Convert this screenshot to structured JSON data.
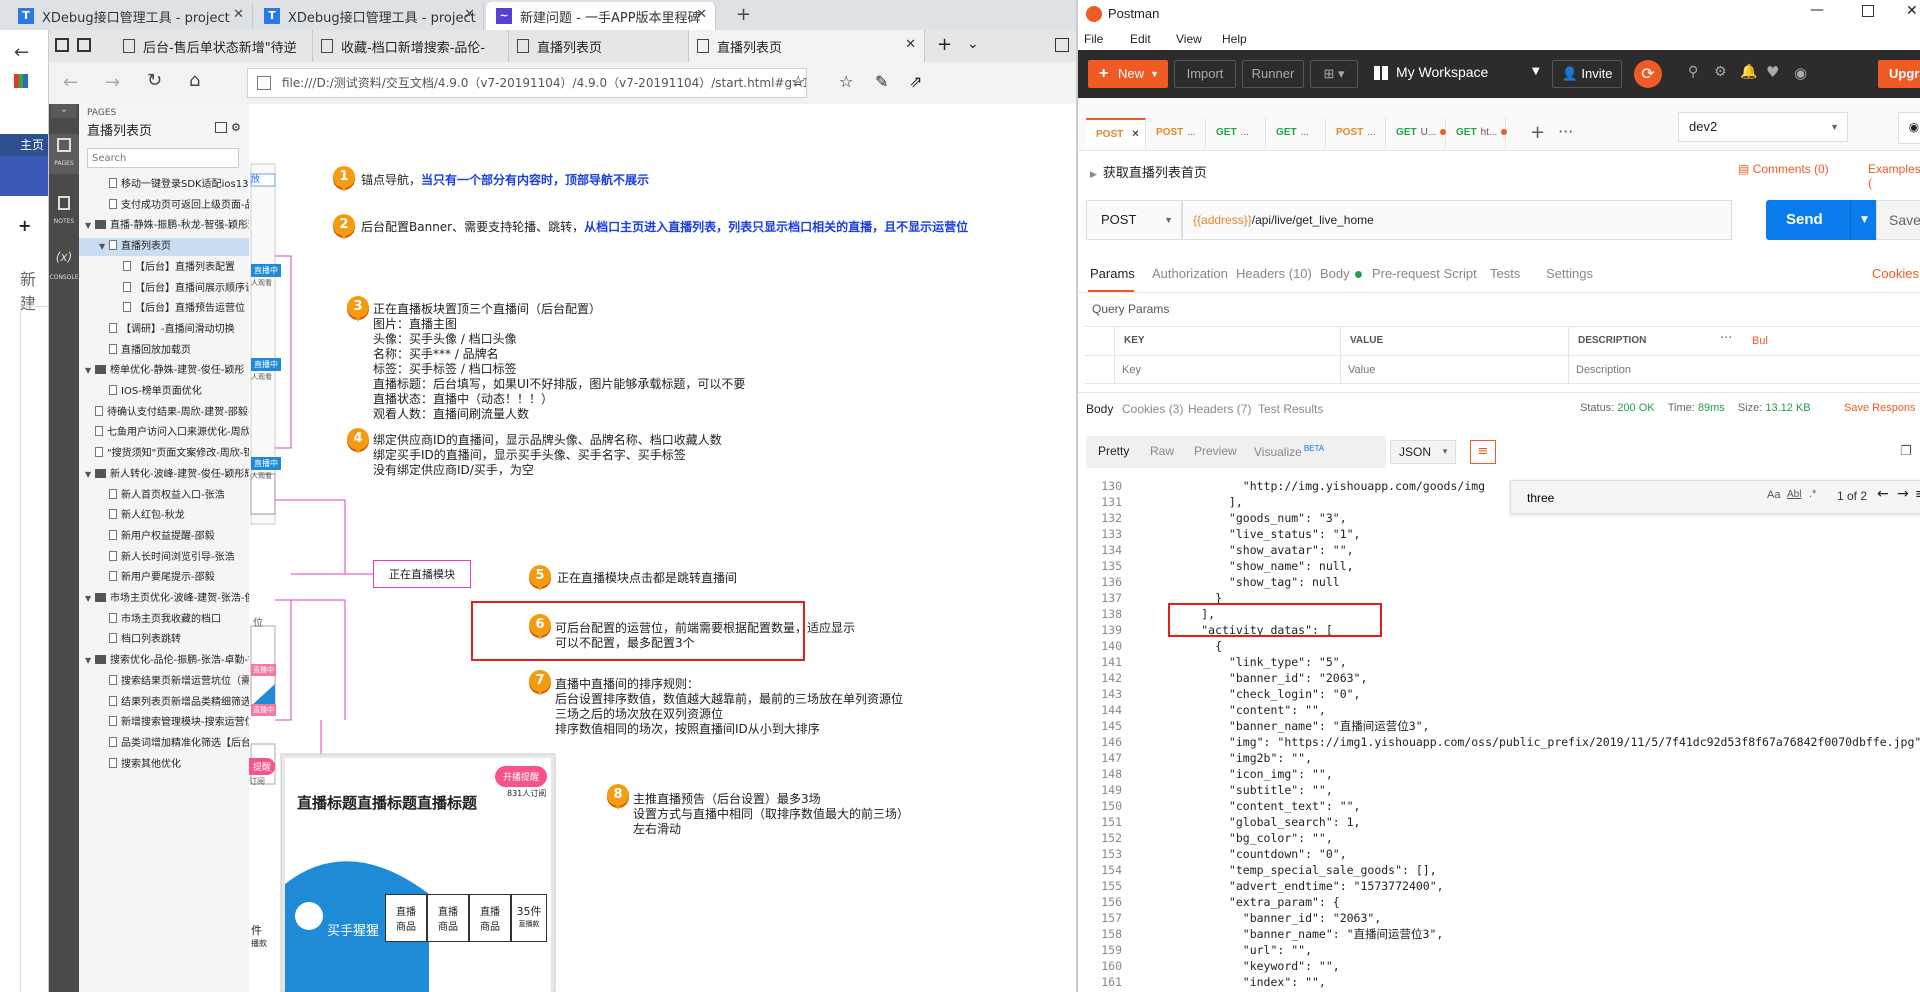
{
  "chrome": {
    "tabs": [
      {
        "label": "XDebug接口管理工具 - project",
        "icon": "T"
      },
      {
        "label": "XDebug接口管理工具 - project",
        "icon": "T"
      },
      {
        "label": "新建问题 - 一手APP版本里程碑",
        "icon": "~"
      }
    ],
    "new_tab": "+",
    "side_texts": [
      "主页",
      "新建"
    ]
  },
  "browser": {
    "tabs": [
      {
        "label": "后台-售后单状态新增\"待逆"
      },
      {
        "label": "收藏-档口新增搜索-品伦-"
      },
      {
        "label": "直播列表页"
      },
      {
        "label": "直播列表页"
      }
    ],
    "address": "file:///D:/测试资料/交互文档/4.9.0（v7-20191104）/4.9.0（v7-20191104）/start.html#g=1&p=直播列表页"
  },
  "axure": {
    "rail": {
      "pages": "PAGES",
      "notes": "NOTES",
      "console": "CONSOLE",
      "console_symbol": "(x)"
    },
    "header_label": "PAGES",
    "title": "直播列表页",
    "search_placeholder": "Search",
    "tree": [
      {
        "label": "移动一键登录SDK适配ios13【ios】-",
        "indent": 1,
        "type": "page"
      },
      {
        "label": "支付成功页可返回上级页面-品伦-建彰",
        "indent": 1,
        "type": "page"
      },
      {
        "label": "直播-静姝-振鹏-秋龙-智强-颖彤辉锋-",
        "indent": 0,
        "type": "folder",
        "open": true
      },
      {
        "label": "直播列表页",
        "indent": 1,
        "type": "page",
        "open": true,
        "selected": true
      },
      {
        "label": "【后台】直播列表配置",
        "indent": 2,
        "type": "page"
      },
      {
        "label": "【后台】直播间展示顺序设置",
        "indent": 2,
        "type": "page"
      },
      {
        "label": "【后台】直播预告运营位",
        "indent": 2,
        "type": "page"
      },
      {
        "label": "【调研】-直播间滑动切换",
        "indent": 1,
        "type": "page"
      },
      {
        "label": "直播回放加载页",
        "indent": 1,
        "type": "page"
      },
      {
        "label": "榜单优化-静姝-建贺-俊任-颖彤",
        "indent": 0,
        "type": "folder",
        "open": true
      },
      {
        "label": "IOS-榜单页面优化",
        "indent": 1,
        "type": "page"
      },
      {
        "label": "待确认支付结果-周欣-建贺-邵毅-卓勤",
        "indent": 0,
        "type": "page"
      },
      {
        "label": "七鱼用户访问入口来源优化-周欣-达尔",
        "indent": 0,
        "type": "page"
      },
      {
        "label": "\"搜货须知\"页面文案修改-周欣-锦星-",
        "indent": 0,
        "type": "page"
      },
      {
        "label": "新人转化-波峰-建贺-俊任-颖彤辉锋",
        "indent": 0,
        "type": "folder",
        "open": true
      },
      {
        "label": "新人首页权益入口-张浩",
        "indent": 1,
        "type": "page"
      },
      {
        "label": "新人红包-秋龙",
        "indent": 1,
        "type": "page"
      },
      {
        "label": "新用户权益提醒-邵毅",
        "indent": 1,
        "type": "page"
      },
      {
        "label": "新人长时间浏览引导-张浩",
        "indent": 1,
        "type": "page"
      },
      {
        "label": "新用户要尾提示-邵毅",
        "indent": 1,
        "type": "page"
      },
      {
        "label": "市场主页优化-波峰-建贺-张浩-俊任-",
        "indent": 0,
        "type": "folder",
        "open": true
      },
      {
        "label": "市场主页我收藏的档口",
        "indent": 1,
        "type": "page"
      },
      {
        "label": "档口列表跳转",
        "indent": 1,
        "type": "page"
      },
      {
        "label": "搜索优化-品伦-振鹏-张浩-卓勤-锦星-",
        "indent": 0,
        "type": "folder",
        "open": true
      },
      {
        "label": "搜索结果页新增运营坑位（需ab",
        "indent": 1,
        "type": "page"
      },
      {
        "label": "结果列表页新增品类精细筛选（需",
        "indent": 1,
        "type": "page"
      },
      {
        "label": "新增搜索管理模块-搜索运营位【",
        "indent": 1,
        "type": "page"
      },
      {
        "label": "品类词增加精准化筛选【后台】",
        "indent": 1,
        "type": "page"
      },
      {
        "label": "搜索其他优化",
        "indent": 1,
        "type": "page"
      }
    ]
  },
  "canvas": {
    "annotations": [
      {
        "num": "1",
        "lines": [
          "锚点导航，"
        ],
        "highlight": "当只有一个部分有内容时，顶部导航不展示"
      },
      {
        "num": "2",
        "lines": [
          "后台配置Banner、需要支持轮播、跳转，"
        ],
        "highlight": "从档口主页进入直播列表，列表只显示档口相关的直播，且不显示运营位"
      },
      {
        "num": "3",
        "lines": [
          "正在直播板块置顶三个直播间（后台配置）",
          "图片：直播主图",
          "头像：买手头像 / 档口头像",
          "名称：买手*** / 品牌名",
          "标签：买手标签 / 档口标签",
          "直播标题：后台填写，如果UI不好排版，图片能够承载标题，可以不要",
          "直播状态：直播中（动态！！！）",
          "观看人数：直播间刷流量人数"
        ]
      },
      {
        "num": "4",
        "lines": [
          "绑定供应商ID的直播间，显示品牌头像、品牌名称、档口收藏人数",
          "绑定买手ID的直播间，显示买手头像、买手名字、买手标签",
          "没有绑定供应商ID/买手，为空"
        ]
      },
      {
        "num": "5",
        "lines": [
          "正在直播模块点击都是跳转直播间"
        ]
      },
      {
        "num": "6",
        "lines": [
          "可后台配置的运营位，前端需要根据配置数量，适应显示",
          "可以不配置，最多配置3个"
        ]
      },
      {
        "num": "7",
        "lines": [
          "直播中直播间的排序规则：",
          "后台设置排序数值，数值越大越靠前，最前的三场放在单列资源位",
          "三场之后的场次放在双列资源位",
          "排序数值相同的场次，按照直播间ID从小到大排序"
        ]
      },
      {
        "num": "8",
        "lines": [
          "主推直播预告（后台设置）最多3场",
          "设置方式与直播中相同（取排序数值最大的前三场）",
          "左右滑动"
        ]
      }
    ],
    "module_label": "正在直播模块",
    "partial_labels": [
      "放",
      "位"
    ],
    "mock_live": {
      "badge": "直播中",
      "viewers": "人观看"
    },
    "mock_card": {
      "title": "直播标题直播标题直播标题",
      "badge": "开播提醒",
      "subscribed": "831人订阅",
      "buyer": "买手猩猩",
      "goods": [
        "直播\n商品",
        "直播\n商品",
        "直播\n商品"
      ],
      "count": "35件",
      "count_sub": "直播款"
    },
    "left_mock": {
      "badge": "提醒",
      "sub": "订阅",
      "count": "件",
      "count_sub": "播款"
    }
  },
  "postman": {
    "title": "Postman",
    "menu": [
      "File",
      "Edit",
      "View",
      "Help"
    ],
    "toolbar": {
      "new": "New",
      "import": "Import",
      "runner": "Runner",
      "workspace": "My Workspace",
      "invite": "Invite",
      "upgrade": "Upgrade"
    },
    "req_tabs": [
      {
        "method": "POST",
        "label": "",
        "closable": true
      },
      {
        "method": "POST",
        "label": "..."
      },
      {
        "method": "GET",
        "label": "..."
      },
      {
        "method": "GET",
        "label": "..."
      },
      {
        "method": "POST",
        "label": "..."
      },
      {
        "method": "GET",
        "label": "U..."
      },
      {
        "method": "GET",
        "label": "ht..."
      }
    ],
    "env": "dev2",
    "request_name": "获取直播列表首页",
    "comments": "Comments (0)",
    "examples": "Examples (",
    "method": "POST",
    "url_var": "{{address}}",
    "url_path": "/api/live/get_live_home",
    "send": "Send",
    "save": "Save",
    "req_sub_tabs": [
      "Params",
      "Authorization",
      "Headers (10)",
      "Body",
      "Pre-request Script",
      "Tests",
      "Settings"
    ],
    "cookies": "Cookies",
    "query_params": "Query Params",
    "table_headers": [
      "KEY",
      "VALUE",
      "DESCRIPTION"
    ],
    "table_placeholders": [
      "Key",
      "Value",
      "Description"
    ],
    "bulk": "Bul",
    "resp_tabs": [
      "Body",
      "Cookies (3)",
      "Headers (7)",
      "Test Results"
    ],
    "status_label": "Status:",
    "status": "200 OK",
    "time_label": "Time:",
    "time": "89ms",
    "size_label": "Size:",
    "size": "13.12 KB",
    "save_response": "Save Respons",
    "view_modes": [
      "Pretty",
      "Raw",
      "Preview",
      "Visualize"
    ],
    "beta": "BETA",
    "format": "JSON",
    "search_value": "three",
    "search_opts": [
      "Aa",
      "Abl",
      ".*"
    ],
    "search_count": "1 of 2",
    "code": [
      {
        "n": "130",
        "t": "                \"http://img.yishouapp.com/goods/img"
      },
      {
        "n": "131",
        "t": "              ],"
      },
      {
        "n": "132",
        "t": "              \"goods_num\": \"3\","
      },
      {
        "n": "133",
        "t": "              \"live_status\": \"1\","
      },
      {
        "n": "134",
        "t": "              \"show_avatar\": \"\","
      },
      {
        "n": "135",
        "t": "              \"show_name\": null,"
      },
      {
        "n": "136",
        "t": "              \"show_tag\": null"
      },
      {
        "n": "137",
        "t": "            }"
      },
      {
        "n": "138",
        "t": "          ],"
      },
      {
        "n": "139",
        "t": "          \"activity_datas\": ["
      },
      {
        "n": "140",
        "t": "            {"
      },
      {
        "n": "141",
        "t": "              \"link_type\": \"5\","
      },
      {
        "n": "142",
        "t": "              \"banner_id\": \"2063\","
      },
      {
        "n": "143",
        "t": "              \"check_login\": \"0\","
      },
      {
        "n": "144",
        "t": "              \"content\": \"\","
      },
      {
        "n": "145",
        "t": "              \"banner_name\": \"直播间运营位3\","
      },
      {
        "n": "146",
        "t": "              \"img\": \"https://img1.yishouapp.com/oss/public_prefix/2019/11/5/7f41dc92d53f8f67a76842f0070dbffe.jpg\","
      },
      {
        "n": "147",
        "t": "              \"img2b\": \"\","
      },
      {
        "n": "148",
        "t": "              \"icon_img\": \"\","
      },
      {
        "n": "149",
        "t": "              \"subtitle\": \"\","
      },
      {
        "n": "150",
        "t": "              \"content_text\": \"\","
      },
      {
        "n": "151",
        "t": "              \"global_search\": 1,"
      },
      {
        "n": "152",
        "t": "              \"bg_color\": \"\","
      },
      {
        "n": "153",
        "t": "              \"countdown\": \"0\","
      },
      {
        "n": "154",
        "t": "              \"temp_special_sale_goods\": [],"
      },
      {
        "n": "155",
        "t": "              \"advert_endtime\": \"1573772400\","
      },
      {
        "n": "156",
        "t": "              \"extra_param\": {"
      },
      {
        "n": "157",
        "t": "                \"banner_id\": \"2063\","
      },
      {
        "n": "158",
        "t": "                \"banner_name\": \"直播间运营位3\","
      },
      {
        "n": "159",
        "t": "                \"url\": \"\","
      },
      {
        "n": "160",
        "t": "                \"keyword\": \"\","
      },
      {
        "n": "161",
        "t": "                \"index\": \"\","
      }
    ]
  }
}
